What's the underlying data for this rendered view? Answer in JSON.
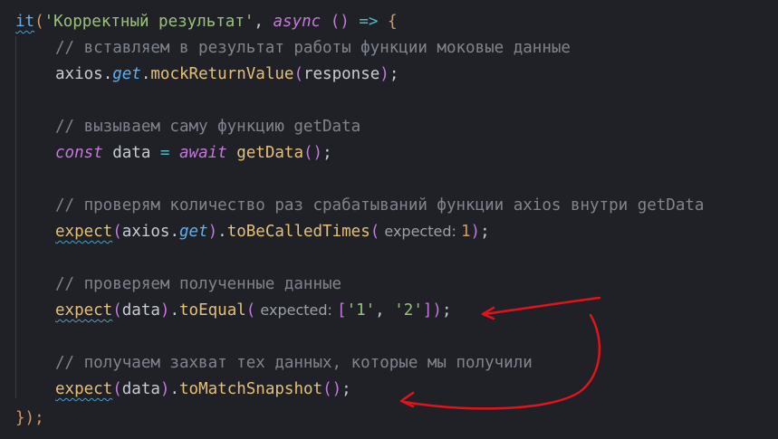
{
  "code": {
    "line1": {
      "it": "it",
      "test_name": "'Корректный результат'",
      "async": "async",
      "rest": " () => {"
    },
    "line2_comment": "// вставляем в результат работы функции моковые данные",
    "line3": {
      "obj": "axios",
      "method": "get",
      "call": "mockReturnValue",
      "arg": "response"
    },
    "line5_comment": "// вызываем саму функцию getData",
    "line6": {
      "const": "const",
      "var": "data",
      "eq": " = ",
      "await": "await",
      "call": "getData"
    },
    "line8_comment": "// проверям количество раз срабатываний функции axios внутри getData",
    "line9": {
      "expect": "expect",
      "obj": "axios",
      "method": "get",
      "matcher": "toBeCalledTimes",
      "hint": "expected:",
      "value": "1"
    },
    "line11_comment": "// проверяем полученные данные",
    "line12": {
      "expect": "expect",
      "arg": "data",
      "matcher": "toEqual",
      "hint": "expected:",
      "v1": "'1'",
      "v2": "'2'"
    },
    "line14_comment": "// получаем захват тех данных, которые мы получили",
    "line15": {
      "expect": "expect",
      "arg": "data",
      "matcher": "toMatchSnapshot"
    },
    "line16_close": "});"
  },
  "colors": {
    "background": "#1f2127",
    "annotation": "#e0141a"
  }
}
